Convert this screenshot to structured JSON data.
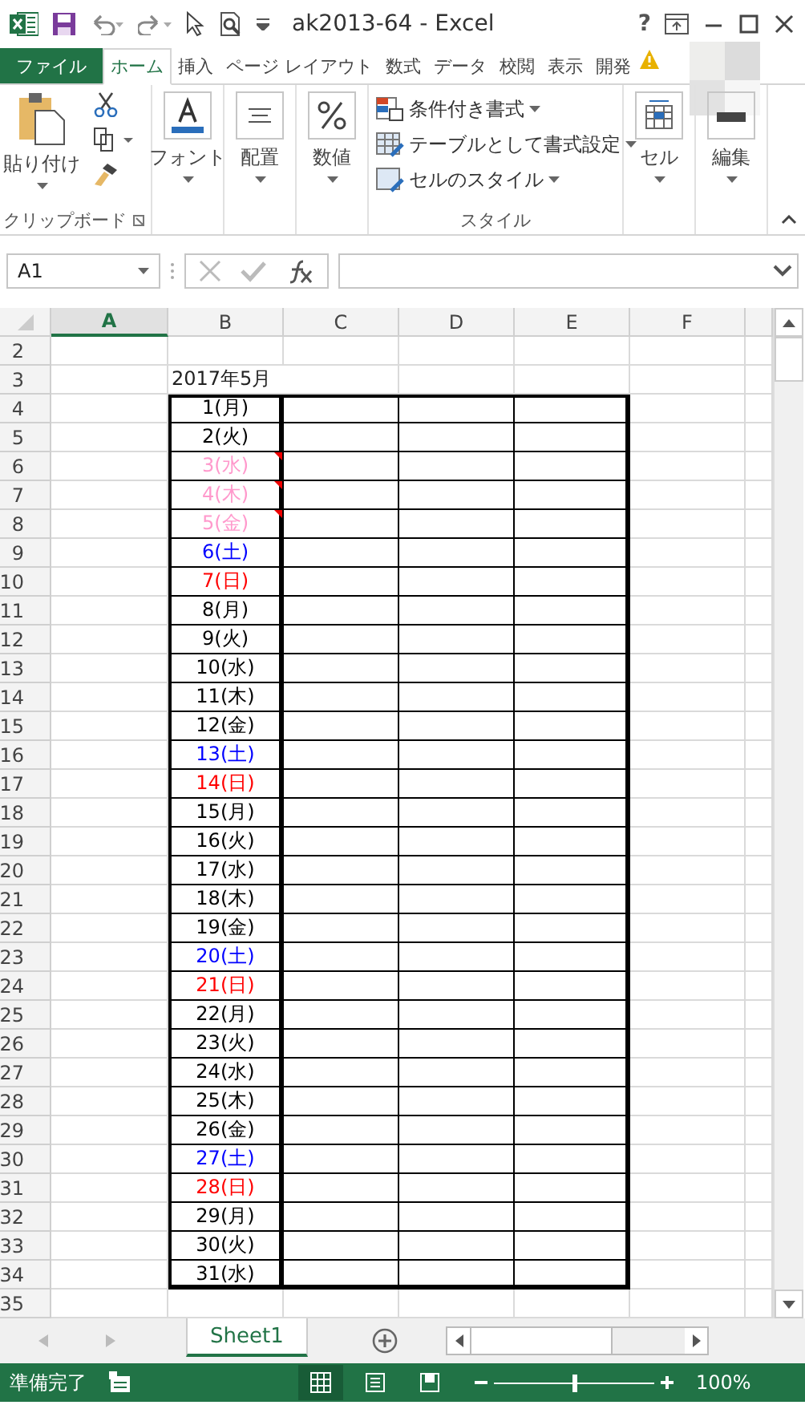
{
  "window": {
    "title": "ak2013-64 - Excel",
    "help": "?"
  },
  "ribbon_tabs": [
    {
      "label": "ファイル",
      "kind": "file",
      "selected": false
    },
    {
      "label": "ホーム",
      "kind": "tab",
      "selected": true
    },
    {
      "label": "挿入",
      "kind": "tab",
      "selected": false
    },
    {
      "label": "ページ レイアウト",
      "kind": "tab",
      "selected": false
    },
    {
      "label": "数式",
      "kind": "tab",
      "selected": false
    },
    {
      "label": "データ",
      "kind": "tab",
      "selected": false
    },
    {
      "label": "校閲",
      "kind": "tab",
      "selected": false
    },
    {
      "label": "表示",
      "kind": "tab",
      "selected": false
    },
    {
      "label": "開発",
      "kind": "tab",
      "selected": false
    }
  ],
  "ribbon": {
    "paste": "貼り付け",
    "clipboard_label": "クリップボード",
    "font": "フォント",
    "alignment": "配置",
    "number": "数値",
    "style_items": [
      "条件付き書式",
      "テーブルとして書式設定",
      "セルのスタイル"
    ],
    "styles_label": "スタイル",
    "cells": "セル",
    "editing": "編集"
  },
  "formula_bar": {
    "name_box": "A1"
  },
  "columns": [
    {
      "label": "A",
      "selected": true
    },
    {
      "label": "B",
      "selected": false
    },
    {
      "label": "C",
      "selected": false
    },
    {
      "label": "D",
      "selected": false
    },
    {
      "label": "E",
      "selected": false
    },
    {
      "label": "F",
      "selected": false
    }
  ],
  "rows": [
    {
      "header": "2"
    },
    {
      "header": "3",
      "title": "2017年5月"
    },
    {
      "header": "4",
      "day": "1(月)",
      "color": "#000000",
      "comment": false
    },
    {
      "header": "5",
      "day": "2(火)",
      "color": "#000000",
      "comment": false
    },
    {
      "header": "6",
      "day": "3(水)",
      "color": "#ff99cc",
      "comment": true
    },
    {
      "header": "7",
      "day": "4(木)",
      "color": "#ff99cc",
      "comment": true
    },
    {
      "header": "8",
      "day": "5(金)",
      "color": "#ff99cc",
      "comment": true
    },
    {
      "header": "9",
      "day": "6(土)",
      "color": "#0000ff",
      "comment": false
    },
    {
      "header": "10",
      "day": "7(日)",
      "color": "#ff0000",
      "comment": false
    },
    {
      "header": "11",
      "day": "8(月)",
      "color": "#000000",
      "comment": false
    },
    {
      "header": "12",
      "day": "9(火)",
      "color": "#000000",
      "comment": false
    },
    {
      "header": "13",
      "day": "10(水)",
      "color": "#000000",
      "comment": false
    },
    {
      "header": "14",
      "day": "11(木)",
      "color": "#000000",
      "comment": false
    },
    {
      "header": "15",
      "day": "12(金)",
      "color": "#000000",
      "comment": false
    },
    {
      "header": "16",
      "day": "13(土)",
      "color": "#0000ff",
      "comment": false
    },
    {
      "header": "17",
      "day": "14(日)",
      "color": "#ff0000",
      "comment": false
    },
    {
      "header": "18",
      "day": "15(月)",
      "color": "#000000",
      "comment": false
    },
    {
      "header": "19",
      "day": "16(火)",
      "color": "#000000",
      "comment": false
    },
    {
      "header": "20",
      "day": "17(水)",
      "color": "#000000",
      "comment": false
    },
    {
      "header": "21",
      "day": "18(木)",
      "color": "#000000",
      "comment": false
    },
    {
      "header": "22",
      "day": "19(金)",
      "color": "#000000",
      "comment": false
    },
    {
      "header": "23",
      "day": "20(土)",
      "color": "#0000ff",
      "comment": false
    },
    {
      "header": "24",
      "day": "21(日)",
      "color": "#ff0000",
      "comment": false
    },
    {
      "header": "25",
      "day": "22(月)",
      "color": "#000000",
      "comment": false
    },
    {
      "header": "26",
      "day": "23(火)",
      "color": "#000000",
      "comment": false
    },
    {
      "header": "27",
      "day": "24(水)",
      "color": "#000000",
      "comment": false
    },
    {
      "header": "28",
      "day": "25(木)",
      "color": "#000000",
      "comment": false
    },
    {
      "header": "29",
      "day": "26(金)",
      "color": "#000000",
      "comment": false
    },
    {
      "header": "30",
      "day": "27(土)",
      "color": "#0000ff",
      "comment": false
    },
    {
      "header": "31",
      "day": "28(日)",
      "color": "#ff0000",
      "comment": false
    },
    {
      "header": "32",
      "day": "29(月)",
      "color": "#000000",
      "comment": false
    },
    {
      "header": "33",
      "day": "30(火)",
      "color": "#000000",
      "comment": false
    },
    {
      "header": "34",
      "day": "31(水)",
      "color": "#000000",
      "comment": false
    },
    {
      "header": "35"
    }
  ],
  "sheet_tabs": [
    {
      "label": "Sheet1",
      "selected": true
    }
  ],
  "status_bar": {
    "status": "準備完了",
    "views": [
      {
        "kind": "normal",
        "selected": true
      },
      {
        "kind": "page_layout",
        "selected": false
      },
      {
        "kind": "page_break",
        "selected": false
      }
    ],
    "zoom": {
      "level": 0.5
    },
    "zoom_label": "100%"
  }
}
